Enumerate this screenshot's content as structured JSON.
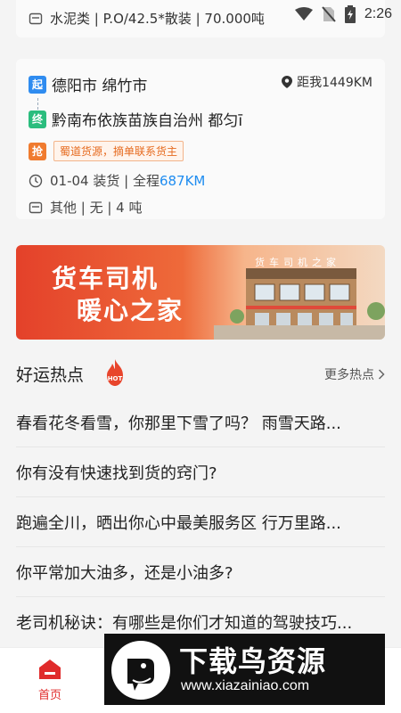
{
  "status_bar": {
    "time": "2:26"
  },
  "previous_card": {
    "info": "水泥类 | P.O/42.5*散装 | 70.000吨"
  },
  "cargo_card": {
    "start_tag": "起",
    "start_city": "德阳市 绵竹市",
    "end_tag": "终",
    "end_city": "黔南布依族苗族自治州 都匀ī",
    "distance": "距我1449KM",
    "grab_tag": "抢",
    "grab_note": "蜀道货源，摘单联系货主",
    "load_date": "01-04 装货 | 全程",
    "total_distance": "687KM",
    "goods": "其他 | 无 | 4 吨"
  },
  "banner": {
    "title_line1": "货车司机",
    "title_line2": "暖心之家",
    "building_sign": "货车司机之家"
  },
  "hot": {
    "title": "好运热点",
    "badge": "HOT",
    "more": "更多热点",
    "topics": [
      "春看花冬看雪，你那里下雪了吗？ 雨雪天路...",
      "你有没有快速找到货的窍门?",
      "跑遍全川，晒出你心中最美服务区 行万里路...",
      "你平常加大油多，还是小油多?",
      "老司机秘诀：有哪些是你们才知道的驾驶技巧..."
    ]
  },
  "nav": {
    "home_label": "首页"
  },
  "watermark": {
    "title": "下载鸟资源",
    "url": "www.xiazainiao.com"
  },
  "colors": {
    "accent": "#1e8cf0",
    "start_tag": "#2f8cf0",
    "end_tag": "#2bbd7e",
    "grab": "#f07b2f",
    "nav_active": "#e02b2b"
  }
}
